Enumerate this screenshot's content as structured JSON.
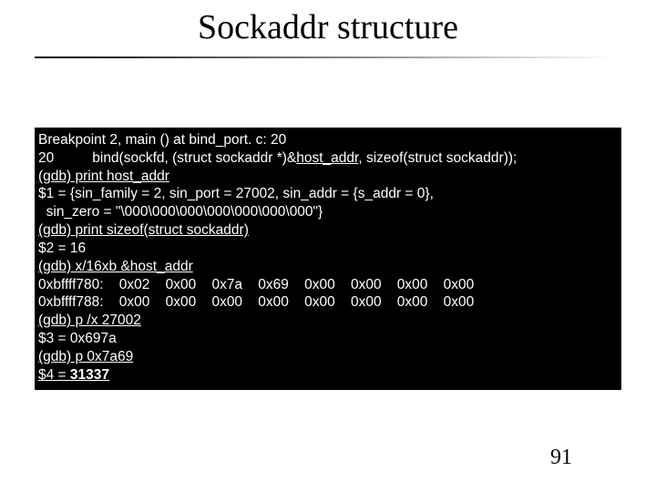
{
  "title": "Sockaddr structure",
  "term": {
    "l1": "Breakpoint 2, main () at bind_port. c: 20",
    "l2a": "20",
    "l2b": "bind(sockfd, (struct sockaddr *)&",
    "l2c": "host_addr",
    "l2d": ", sizeof(struct sockaddr));",
    "l3a": "(gdb) print ",
    "l3b": "host_addr",
    "l4": "$1 = {sin_family = 2, sin_port = 27002, sin_addr = {s_addr = 0},",
    "l5": "  sin_zero = \"\\000\\000\\000\\000\\000\\000\\000\"}",
    "l6a": "(gdb) ",
    "l6b": "print sizeof(struct sockaddr)",
    "l7": "$2 = 16",
    "l8a": "(gdb) ",
    "l8b": "x/16xb &host_addr",
    "l9": "0xbffff780:    0x02    0x00    0x7a    0x69    0x00    0x00    0x00    0x00",
    "l10": "0xbffff788:    0x00    0x00    0x00    0x00    0x00    0x00    0x00    0x00",
    "l11a": "(gdb) p /x ",
    "l11b": "27002",
    "l12": "$3 = 0x697a",
    "l13a": "(gdb) p ",
    "l13b": "0x7a69",
    "l14a": "$4 = ",
    "l14b": "31337"
  },
  "page_number": "91"
}
